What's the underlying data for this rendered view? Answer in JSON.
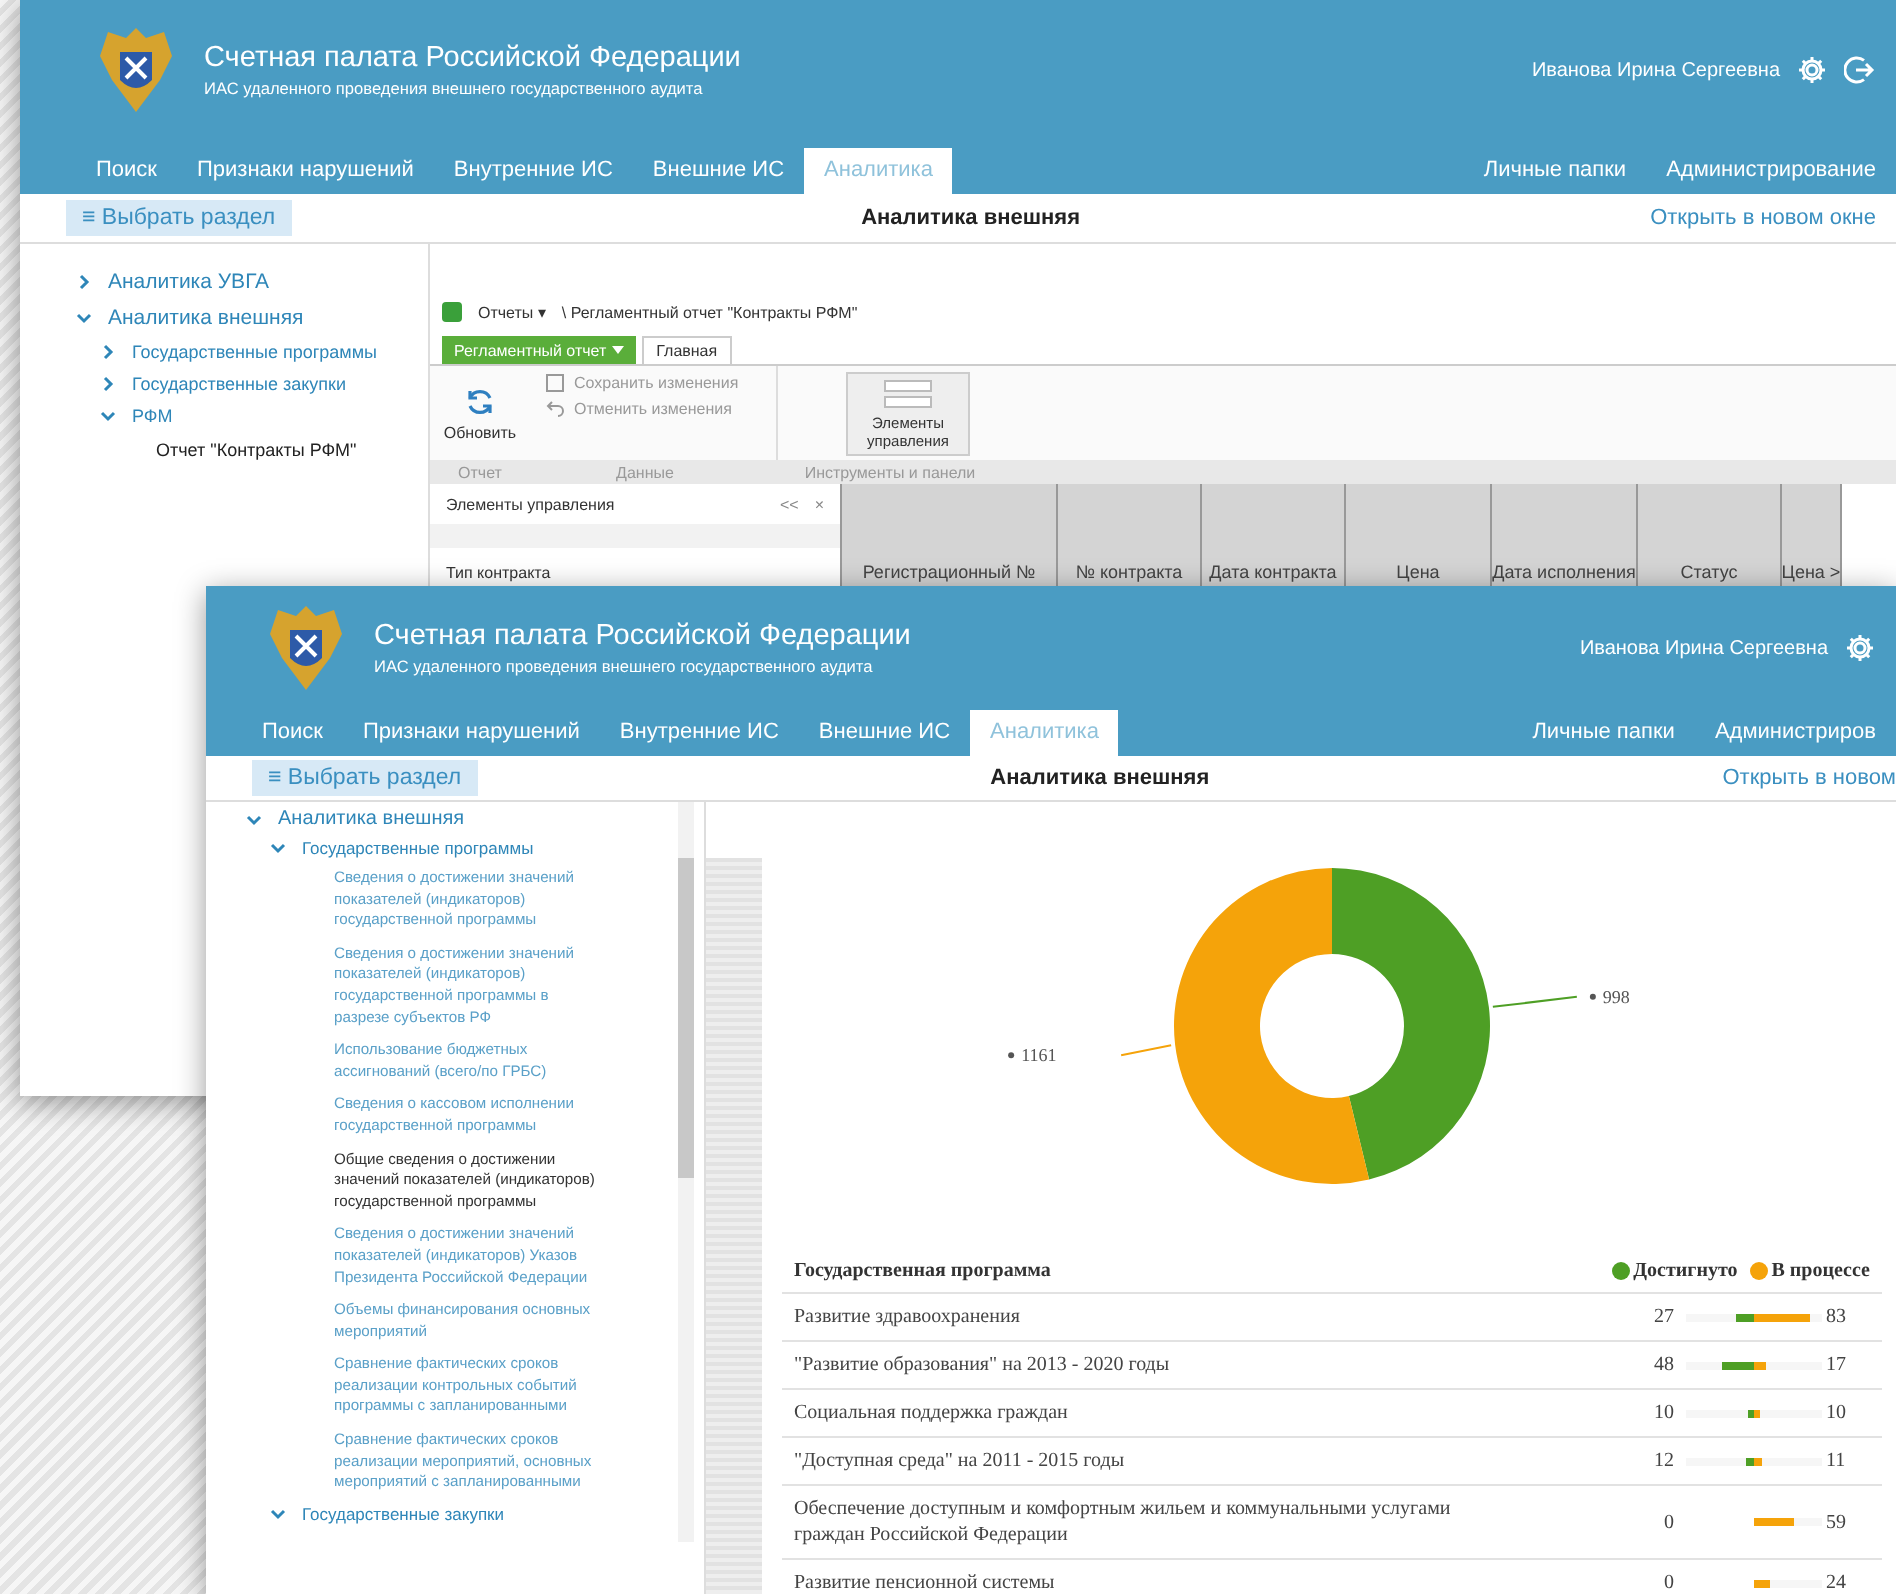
{
  "back_window": {
    "header": {
      "title": "Счетная палата Российской Федерации",
      "subtitle": "ИАС удаленного проведения внешнего государственного аудита",
      "user": "Иванова Ирина Сергеевна"
    },
    "nav": [
      {
        "label": "Поиск",
        "selected": false
      },
      {
        "label": "Признаки нарушений",
        "selected": false
      },
      {
        "label": "Внутренние ИС",
        "selected": false
      },
      {
        "label": "Внешние ИС",
        "selected": false
      },
      {
        "label": "Аналитика",
        "selected": true
      }
    ],
    "nav_right": [
      {
        "label": "Личные папки",
        "selected": false
      },
      {
        "label": "Администрирование",
        "selected": false
      }
    ],
    "section_button": "≡ Выбрать раздел",
    "page_title": "Аналитика внешняя",
    "open_link": "Открыть в новом окне",
    "sidebar": [
      {
        "label": "Аналитика УВГА",
        "expanded": false
      },
      {
        "label": "Аналитика внешняя",
        "expanded": true,
        "children": [
          {
            "label": "Государственные программы",
            "expanded": false
          },
          {
            "label": "Государственные закупки",
            "expanded": false
          },
          {
            "label": "РФМ",
            "expanded": true,
            "children": [
              {
                "label": "Отчет \"Контракты РФМ\"",
                "selected": true
              }
            ]
          }
        ]
      }
    ],
    "report": {
      "menu": "Отчеты",
      "menu_caret": "▾",
      "path": "\\ Регламентный отчет \"Контракты РФМ\"",
      "report_menu": "Регламентный отчет",
      "ribbon_tabs": [
        {
          "label": "Главная",
          "selected": true
        }
      ],
      "refresh": "Обновить",
      "actions": [
        {
          "label": "Сохранить изменения",
          "disabled": true
        },
        {
          "label": "Отменить изменения",
          "disabled": true
        }
      ],
      "elements_button": "Элементы управления",
      "groups": [
        "Отчет",
        "Данные",
        "Инструменты и панели"
      ],
      "panel_title": "Элементы управления",
      "panel_controls": [
        "<<",
        "×"
      ],
      "filter_label": "Тип контракта",
      "columns": [
        "Регистрационный №",
        "№ контракта",
        "Дата контракта",
        "Цена",
        "Дата исполнения",
        "Статус",
        "Цена >"
      ]
    }
  },
  "front_window": {
    "header": {
      "title": "Счетная палата Российской Федерации",
      "subtitle": "ИАС удаленного проведения внешнего государственного аудита",
      "user": "Иванова Ирина Сергеевна"
    },
    "nav": [
      {
        "label": "Поиск",
        "selected": false
      },
      {
        "label": "Признаки нарушений",
        "selected": false
      },
      {
        "label": "Внутренние ИС",
        "selected": false
      },
      {
        "label": "Внешние ИС",
        "selected": false
      },
      {
        "label": "Аналитика",
        "selected": true
      }
    ],
    "nav_right": [
      {
        "label": "Личные папки",
        "selected": false
      },
      {
        "label": "Администриров",
        "selected": false
      }
    ],
    "section_button": "≡ Выбрать раздел",
    "page_title": "Аналитика внешняя",
    "open_link": "Открыть в новом",
    "sidebar": [
      {
        "label": "Аналитика внешняя",
        "expanded": true,
        "children": [
          {
            "label": "Государственные программы",
            "expanded": true,
            "children": [
              {
                "label": "Сведения о достижении значений показателей (индикаторов) государственной программы",
                "selected": false
              },
              {
                "label": "Сведения о достижении значений показателей (индикаторов) государственной программы в разрезе субъектов РФ",
                "selected": false
              },
              {
                "label": "Использование бюджетных ассигнований (всего/по ГРБС)",
                "selected": false
              },
              {
                "label": "Сведения о кассовом исполнении государственной программы",
                "selected": false
              },
              {
                "label": "Общие сведения о достижении значений показателей (индикаторов) государственной программы",
                "selected": true
              },
              {
                "label": "Сведения о достижении значений показателей (индикаторов) Указов Президента Российской Федерации",
                "selected": false
              },
              {
                "label": "Объемы финансирования основных мероприятий",
                "selected": false
              },
              {
                "label": "Сравнение фактических сроков реализации контрольных событий программы с запланированными",
                "selected": false
              },
              {
                "label": "Сравнение фактических сроков реализации мероприятий, основных мероприятий с запланированными",
                "selected": false
              }
            ]
          },
          {
            "label": "Государственные закупки",
            "expanded": true
          }
        ]
      }
    ],
    "chart_data": {
      "type": "donut",
      "values": [
        998,
        1161
      ],
      "value_labels": [
        "998",
        "1161"
      ]
    },
    "table": {
      "header": "Государственная программа",
      "legend": [
        {
          "label": "Достигнуто",
          "color": "#4e9f25"
        },
        {
          "label": "В процессе",
          "color": "#f5a30a"
        }
      ],
      "rows": [
        {
          "name": "Развитие здравоохранения",
          "achieved": "27",
          "in_progress": "83",
          "achieved_bar": {
            "level": 0.27
          },
          "in_progress_bar": {
            "level": 0.83
          }
        },
        {
          "name": "\"Развитие образования\" на 2013 - 2020 годы",
          "achieved": "48",
          "in_progress": "17",
          "achieved_bar": {
            "level": 0.48
          },
          "in_progress_bar": {
            "level": 0.17
          }
        },
        {
          "name": "Социальная поддержка граждан",
          "achieved": "10",
          "in_progress": "10",
          "achieved_bar": {
            "level": 0.1
          },
          "in_progress_bar": {
            "level": 0.1
          }
        },
        {
          "name": "\"Доступная среда\" на 2011 - 2015 годы",
          "achieved": "12",
          "in_progress": "11",
          "achieved_bar": {
            "level": 0.12
          },
          "in_progress_bar": {
            "level": 0.11
          }
        },
        {
          "name": "Обеспечение доступным и комфортным жильем и коммунальными услугами граждан Российской Федерации",
          "achieved": "0",
          "in_progress": "59",
          "in_progress_bar": {
            "level": 0.59
          }
        },
        {
          "name": "Развитие пенсионной системы",
          "achieved": "0",
          "in_progress": "24",
          "in_progress_bar": {
            "level": 0.24
          }
        }
      ]
    }
  }
}
